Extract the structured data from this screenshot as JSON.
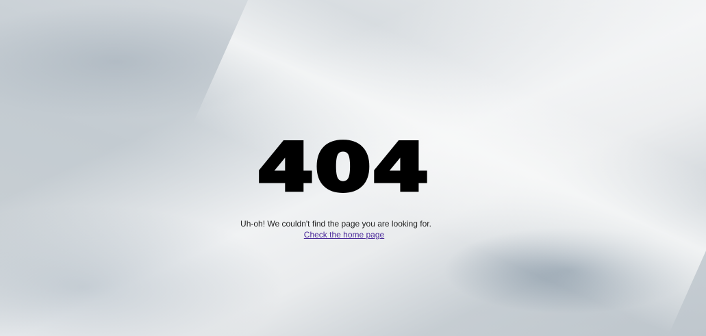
{
  "error": {
    "code": "404",
    "message": "Uh-oh! We couldn't find the page you are looking for.",
    "home_link": "Check the home page"
  },
  "colors": {
    "code_text": "#000000",
    "message_text": "#222222",
    "link": "#4b2a9a"
  }
}
